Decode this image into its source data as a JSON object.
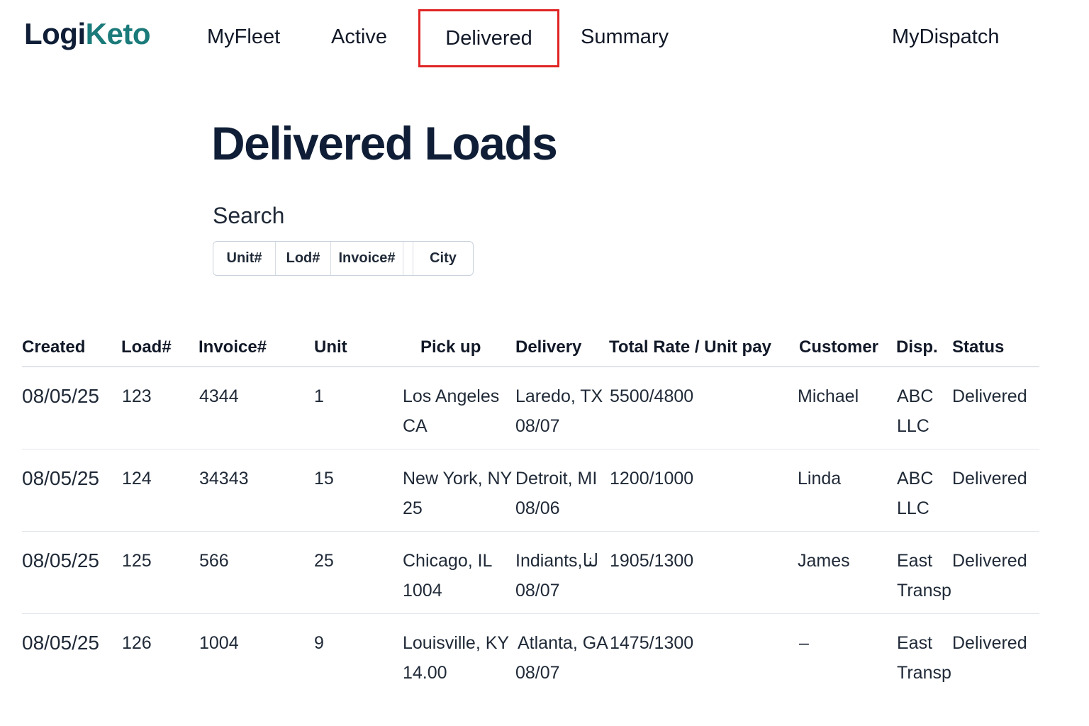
{
  "brand": {
    "part1": "Logi",
    "part2": "Keto"
  },
  "nav": {
    "items": [
      "MyFleet",
      "Active",
      "Delivered",
      "Summary"
    ],
    "active": "Delivered",
    "right": "MyDispatch"
  },
  "page": {
    "title": "Delivered Loads"
  },
  "search": {
    "label": "Search",
    "fields": [
      "Unit#",
      "Lod#",
      "Invoice#",
      "City"
    ]
  },
  "table": {
    "headers": [
      "Created",
      "Load#",
      "Invoice#",
      "Unit",
      "Pick up",
      "Delivery",
      "Total Rate / Unit pay",
      "Customer",
      "Disp.",
      "Status"
    ],
    "rows": [
      {
        "created": "08/05/25",
        "load": "123",
        "invoice": "4344",
        "unit": "1",
        "pickup1": "Los Angeles",
        "pickup2": "CA",
        "delivery1": "Laredo, TX",
        "delivery2": "08/07",
        "rate": "5500/4800",
        "customer": "Michael",
        "disp1": "ABC",
        "disp2": "LLC",
        "status": "Delivered"
      },
      {
        "created": "08/05/25",
        "load": "124",
        "invoice": "34343",
        "unit": "15",
        "pickup1": "New York, NY",
        "pickup2": "25",
        "delivery1": "Detroit, MI",
        "delivery2": "08/06",
        "rate": "1200/1000",
        "customer": "Linda",
        "disp1": "ABC",
        "disp2": "LLC",
        "status": "Delivered"
      },
      {
        "created": "08/05/25",
        "load": "125",
        "invoice": "566",
        "unit": "25",
        "pickup1": "Chicago, IL",
        "pickup2": "1004",
        "delivery1": "Indiants,لنا",
        "delivery2": "08/07",
        "rate": "1905/1300",
        "customer": "James",
        "disp1": "East",
        "disp2": "Transp",
        "status": "Delivered"
      },
      {
        "created": "08/05/25",
        "load": "126",
        "invoice": "1004",
        "unit": "9",
        "pickup1": "Louisville, KY",
        "pickup2": "14.00",
        "delivery1": "Atlanta, GA",
        "delivery2": "08/07",
        "rate": "1475/1300",
        "customer": "–",
        "disp1": "East",
        "disp2": "Transp",
        "status": "Delivered"
      }
    ]
  }
}
